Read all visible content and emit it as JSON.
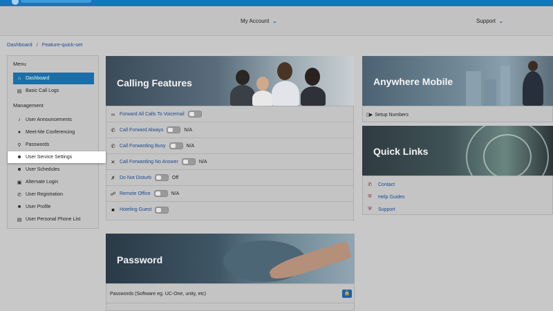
{
  "header": {
    "nav": [
      {
        "label": "My Account"
      },
      {
        "label": "Support"
      }
    ]
  },
  "breadcrumb": [
    "Dashboard",
    "Feature-quick-set"
  ],
  "sidebar": {
    "menu_heading": "Menu",
    "menu_items": [
      {
        "label": "Dashboard",
        "icon": "home-icon"
      },
      {
        "label": "Basic Call Logs",
        "icon": "list-icon"
      }
    ],
    "management_heading": "Management",
    "management_items": [
      {
        "label": "User Announcements",
        "icon": "speaker-icon"
      },
      {
        "label": "Meet-Me Conferencing",
        "icon": "people-icon"
      },
      {
        "label": "Passwords",
        "icon": "key-icon"
      },
      {
        "label": "User Service Settings",
        "icon": "user-settings-icon"
      },
      {
        "label": "User Schedules",
        "icon": "calendar-user-icon"
      },
      {
        "label": "Alternate Login",
        "icon": "id-card-icon"
      },
      {
        "label": "User Registration",
        "icon": "phone-icon"
      },
      {
        "label": "User Profile",
        "icon": "profile-icon"
      },
      {
        "label": "User Personal Phone List",
        "icon": "address-book-icon"
      }
    ]
  },
  "calling": {
    "title": "Calling Features",
    "features": [
      {
        "label": "Forward All Calls To Voicemail",
        "icon": "voicemail-icon",
        "status": ""
      },
      {
        "label": "Call Forward Always",
        "icon": "phone-forward-icon",
        "status": "N/A"
      },
      {
        "label": "Call Forwarding Busy",
        "icon": "phone-busy-icon",
        "status": "N/A"
      },
      {
        "label": "Call Forwarding No Answer",
        "icon": "phone-missed-icon",
        "status": "N/A"
      },
      {
        "label": "Do Not Disturb",
        "icon": "bell-off-icon",
        "status": "Off"
      },
      {
        "label": "Remote Office",
        "icon": "remote-office-icon",
        "status": "N/A"
      },
      {
        "label": "Hoteling Guest",
        "icon": "hotel-icon",
        "status": ""
      }
    ]
  },
  "mobile": {
    "title": "Anywhere Mobile",
    "setup_label": "Setup Numbers"
  },
  "quick_links": {
    "title": "Quick Links",
    "links": [
      {
        "label": "Contact"
      },
      {
        "label": "Help Guides"
      },
      {
        "label": "Support"
      }
    ]
  },
  "password": {
    "title": "Password",
    "row_label": "Passwords (Software eg. UC-One, unity, etc)"
  },
  "colors": {
    "brand": "#1578b5",
    "active_item": "#1a6fa8",
    "link": "#1b4a8f"
  }
}
